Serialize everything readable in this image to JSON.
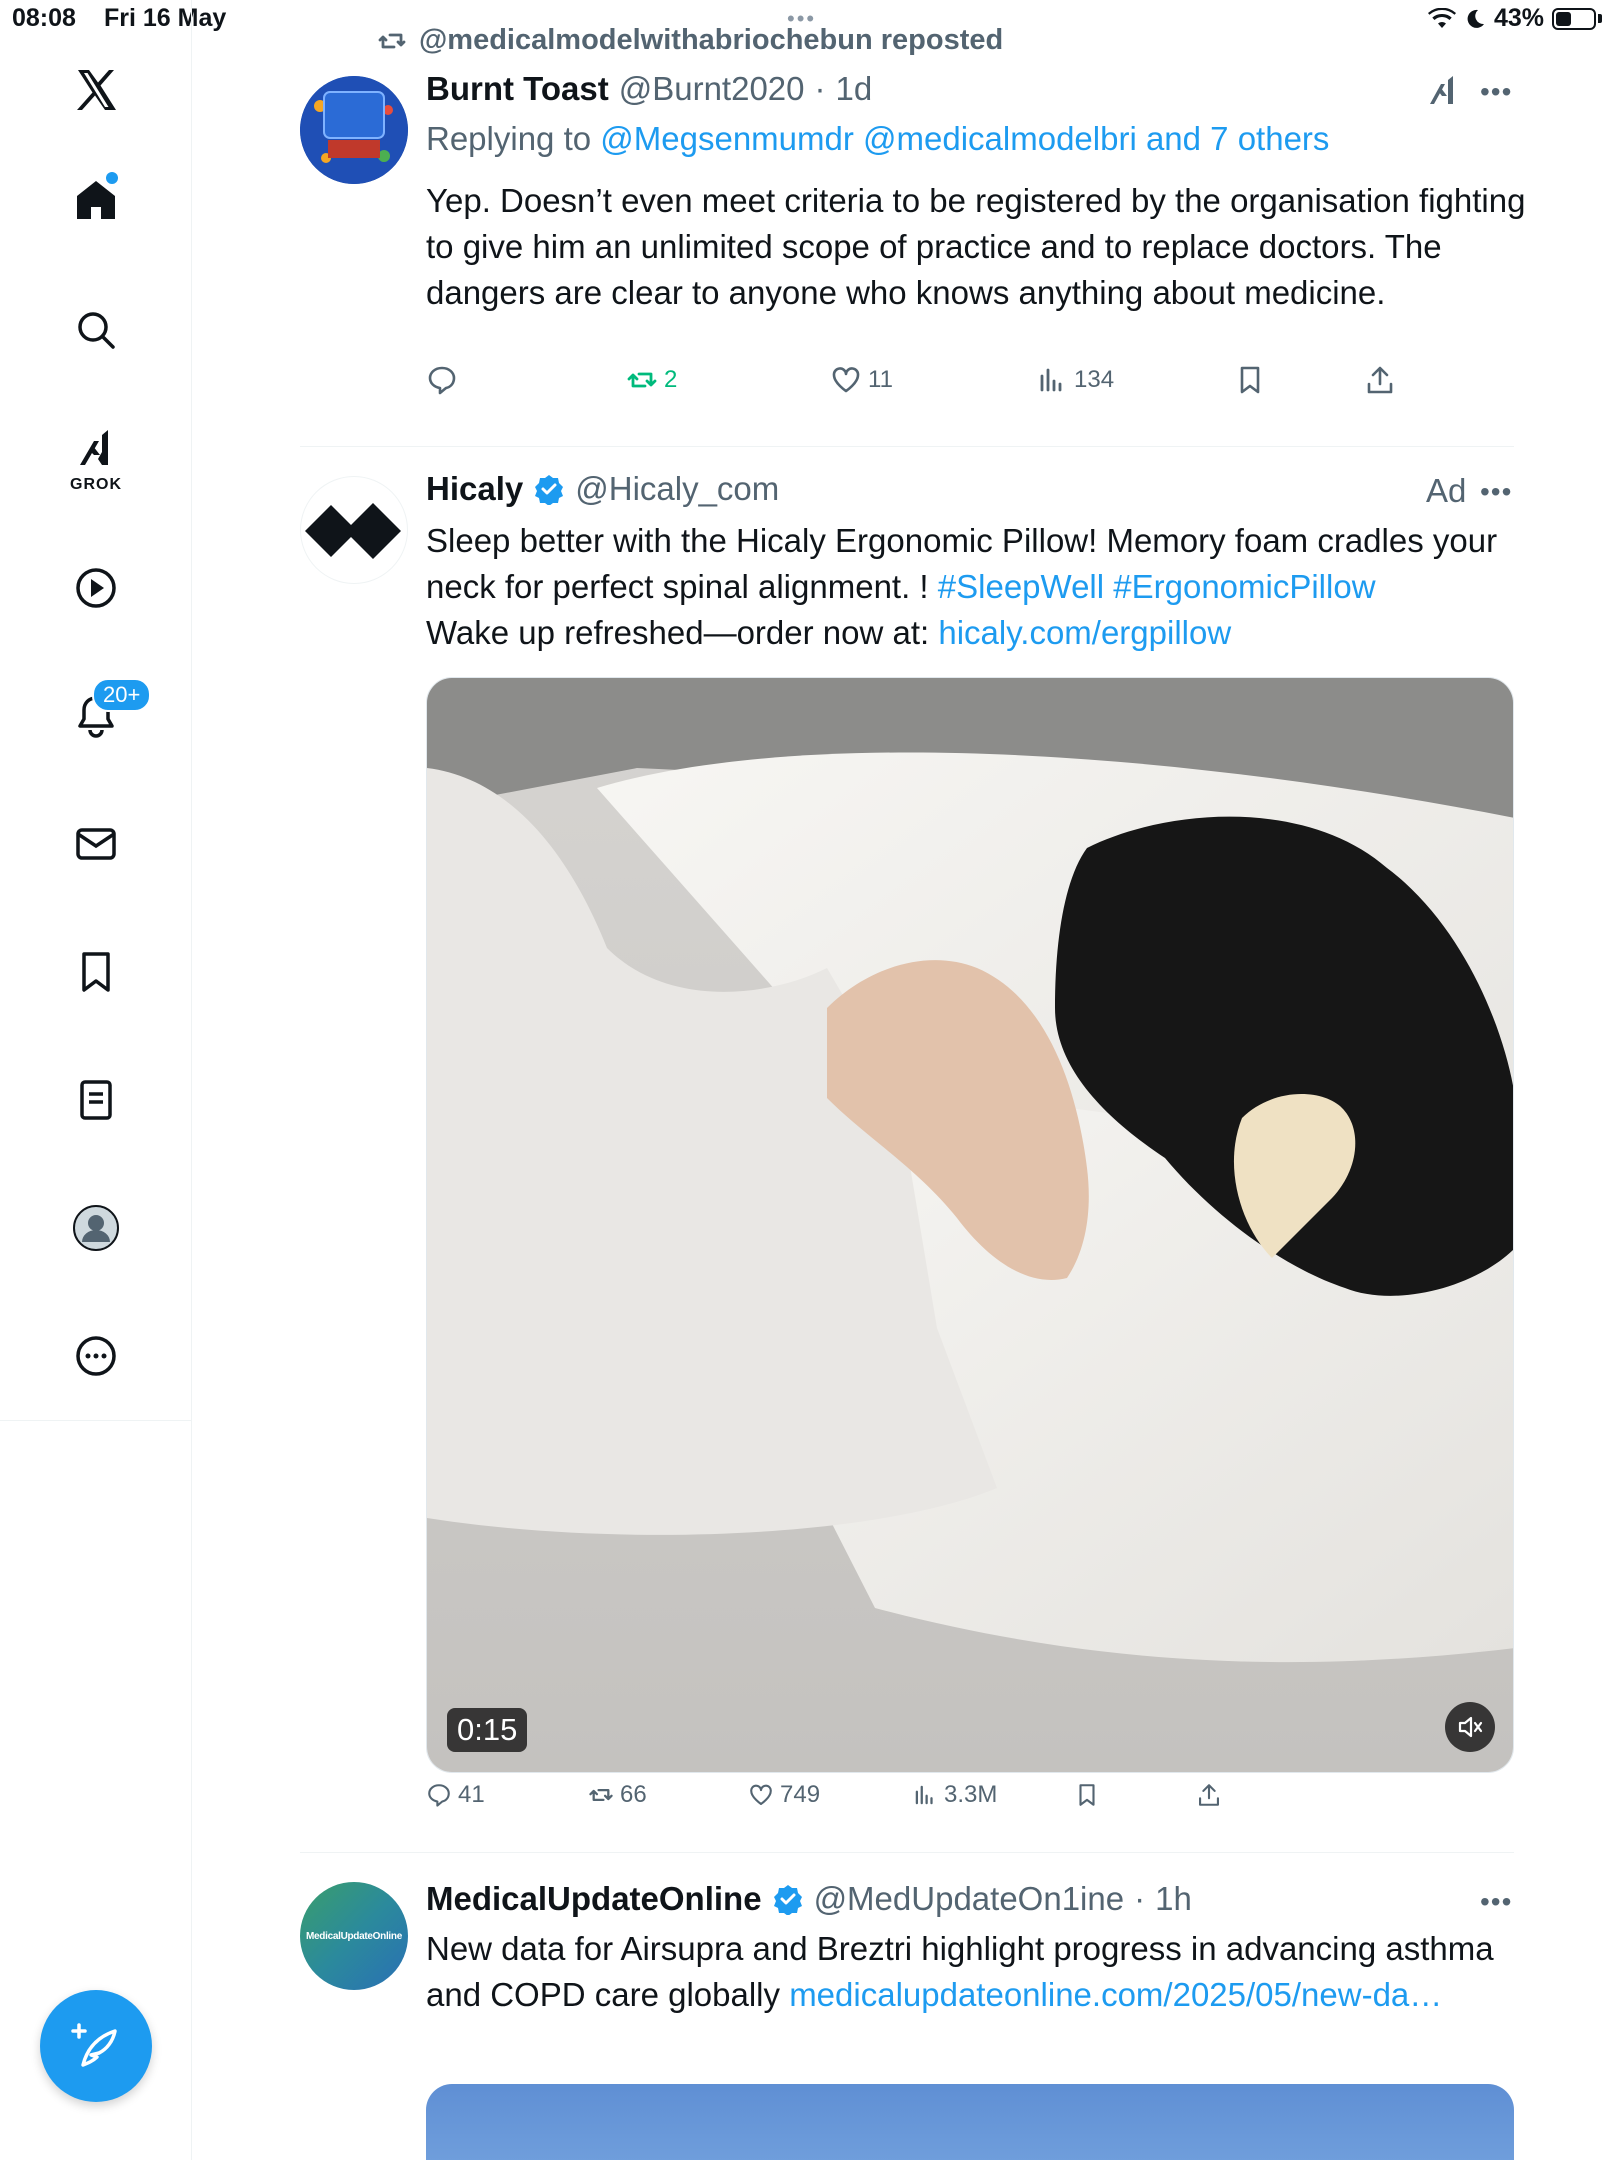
{
  "status_bar": {
    "time": "08:08",
    "date": "Fri 16 May",
    "battery": "43%",
    "battery_level": 0.43
  },
  "sidebar": {
    "items": [
      {
        "name": "x-logo"
      },
      {
        "name": "home",
        "badge_dot": true
      },
      {
        "name": "search"
      },
      {
        "name": "grok",
        "label": "GROK"
      },
      {
        "name": "videos"
      },
      {
        "name": "notifications",
        "badge": "20+"
      },
      {
        "name": "messages"
      },
      {
        "name": "bookmarks"
      },
      {
        "name": "lists"
      },
      {
        "name": "profile"
      },
      {
        "name": "more"
      }
    ],
    "compose_icon": "compose-icon"
  },
  "posts": [
    {
      "repost_by": "@medicalmodelwithabriochebun reposted",
      "name": "Burnt Toast",
      "handle": "@Burnt2020",
      "time": "1d",
      "reply_prefix": "Replying to",
      "reply_to": "@Megsenmumdr @medicalmodelbri and 7 others",
      "text": "Yep. Doesn’t even meet criteria to be registered by the organisation fighting to give him an unlimited scope of practice and to replace doctors. The dangers are clear to anyone who knows anything about medicine.",
      "replies": "",
      "reposts": "2",
      "likes": "11",
      "views": "134"
    },
    {
      "name": "Hicaly",
      "handle": "@Hicaly_com",
      "ad_label": "Ad",
      "text_main": "Sleep better with the Hicaly Ergonomic Pillow! Memory foam cradles your neck for perfect spinal alignment. ! ",
      "hashtags": "#SleepWell #ErgonomicPillow",
      "text_cta": "Wake up refreshed—order now at: ",
      "link": "hicaly.com/ergpillow",
      "video_time": "0:15",
      "replies": "41",
      "reposts": "66",
      "likes": "749",
      "views": "3.3M"
    },
    {
      "name": "MedicalUpdateOnline",
      "handle": "@MedUpdateOn1ine",
      "time": "1h",
      "avatar_text": "MedicalUpdateOnline",
      "text_main": "New data for Airsupra and Breztri highlight progress in advancing asthma and COPD care globally ",
      "link": "medicalupdateonline.com/2025/05/new-da…"
    }
  ],
  "colors": {
    "accent": "#1d9bf0",
    "repost_green": "#00ba7c",
    "secondary_text": "#536471"
  }
}
